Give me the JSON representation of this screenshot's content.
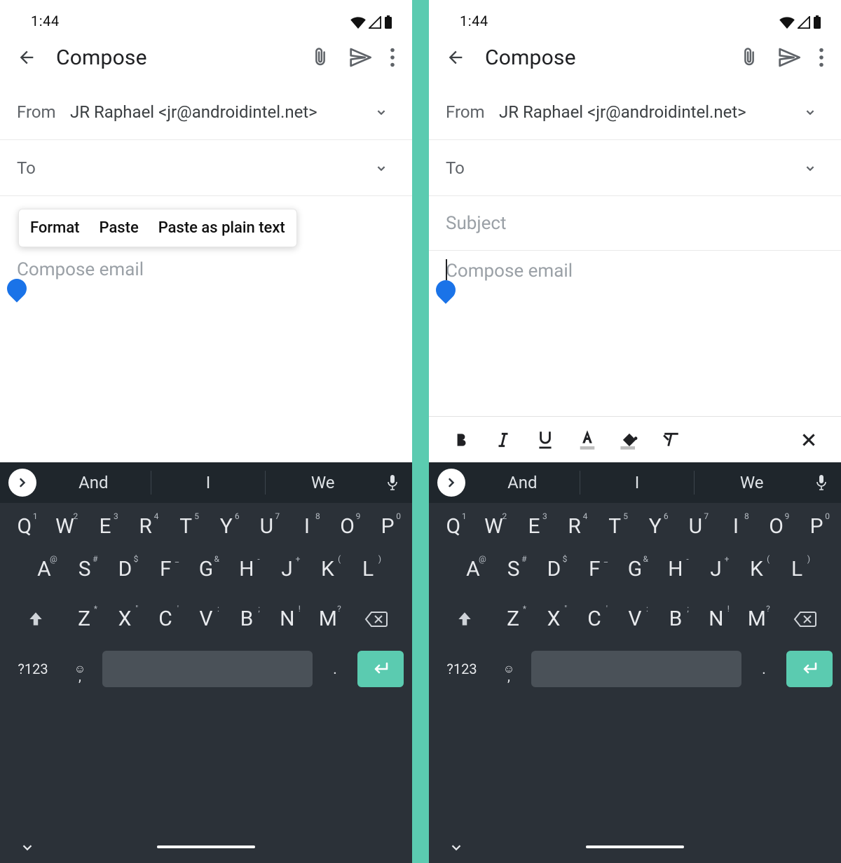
{
  "statusbar": {
    "time": "1:44"
  },
  "appbar": {
    "title": "Compose"
  },
  "from": {
    "label": "From",
    "value": "JR Raphael <jr@androidintel.net>"
  },
  "to": {
    "label": "To",
    "value": ""
  },
  "subject": {
    "placeholder": "Subject"
  },
  "body": {
    "placeholder": "Compose email"
  },
  "context_menu": {
    "items": [
      "Format",
      "Paste",
      "Paste as plain text"
    ]
  },
  "format_bar": {
    "items": [
      "bold",
      "italic",
      "underline",
      "text-color",
      "highlight",
      "clear",
      "close"
    ]
  },
  "keyboard": {
    "suggestions": [
      "And",
      "I",
      "We"
    ],
    "row1": [
      {
        "k": "Q",
        "s": "1"
      },
      {
        "k": "W",
        "s": "2"
      },
      {
        "k": "E",
        "s": "3"
      },
      {
        "k": "R",
        "s": "4"
      },
      {
        "k": "T",
        "s": "5"
      },
      {
        "k": "Y",
        "s": "6"
      },
      {
        "k": "U",
        "s": "7"
      },
      {
        "k": "I",
        "s": "8"
      },
      {
        "k": "O",
        "s": "9"
      },
      {
        "k": "P",
        "s": "0"
      }
    ],
    "row2": [
      {
        "k": "A",
        "s": "@"
      },
      {
        "k": "S",
        "s": "#"
      },
      {
        "k": "D",
        "s": "$"
      },
      {
        "k": "F",
        "s": "_"
      },
      {
        "k": "G",
        "s": "&"
      },
      {
        "k": "H",
        "s": "-"
      },
      {
        "k": "J",
        "s": "+"
      },
      {
        "k": "K",
        "s": "("
      },
      {
        "k": "L",
        "s": ")"
      }
    ],
    "row3": [
      {
        "k": "Z",
        "s": "*"
      },
      {
        "k": "X",
        "s": "\""
      },
      {
        "k": "C",
        "s": "'"
      },
      {
        "k": "V",
        "s": ":"
      },
      {
        "k": "B",
        "s": ";"
      },
      {
        "k": "N",
        "s": "!"
      },
      {
        "k": "M",
        "s": "?"
      }
    ],
    "sym_label": "?123",
    "emoji_glyph": "☺",
    "period": "."
  },
  "colors": {
    "accent": "#1a73e8",
    "enter": "#5bcbb0"
  }
}
